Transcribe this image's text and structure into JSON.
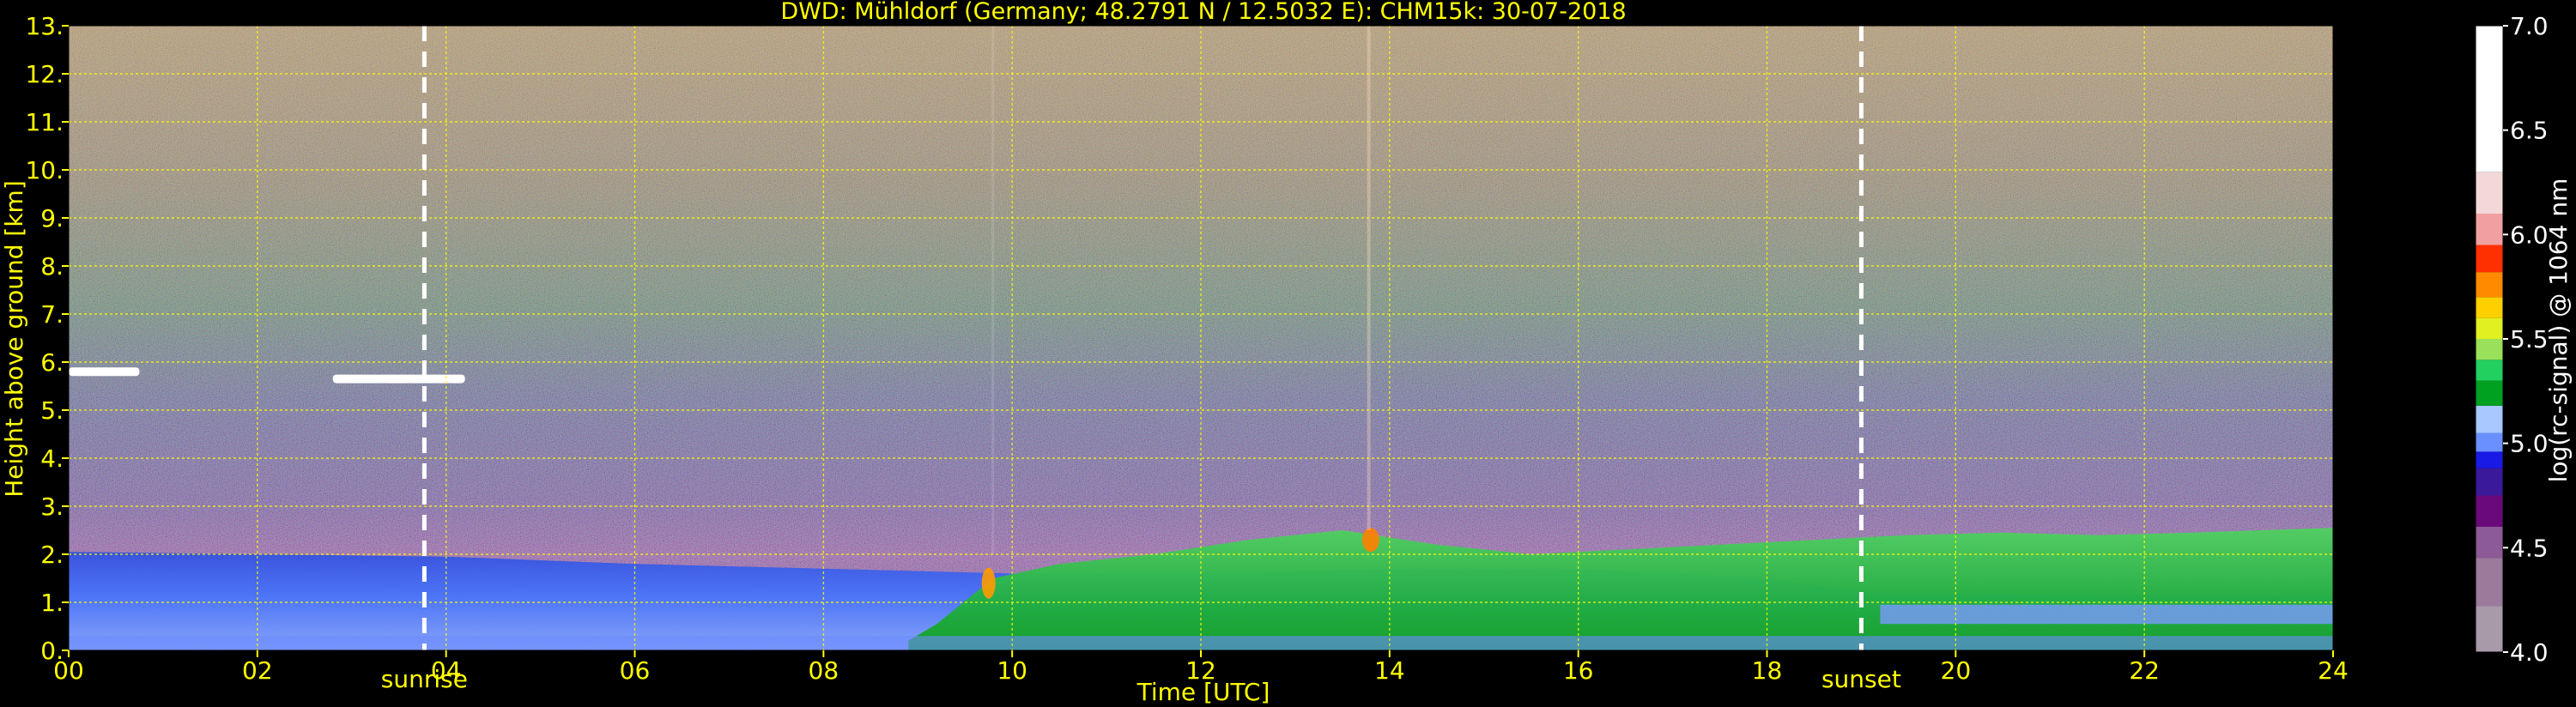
{
  "chart_data": {
    "type": "heatmap",
    "title": "DWD: Mühldorf (Germany; 48.2791 N / 12.5032 E):    CHM15k: 30-07-2018",
    "xlabel": "Time [UTC]",
    "ylabel": "Height above ground [km]",
    "xlim": [
      0,
      24
    ],
    "ylim": [
      0,
      13
    ],
    "x_ticks": [
      0,
      2,
      4,
      6,
      8,
      10,
      12,
      14,
      16,
      18,
      20,
      22,
      24
    ],
    "x_tick_labels": [
      "00",
      "02",
      "04",
      "06",
      "08",
      "10",
      "12",
      "14",
      "16",
      "18",
      "20",
      "22",
      "24"
    ],
    "y_ticks": [
      0,
      1,
      2,
      3,
      4,
      5,
      6,
      7,
      8,
      9,
      10,
      11,
      12,
      13
    ],
    "y_tick_labels": [
      "0.",
      "1.",
      "2.",
      "3.",
      "4.",
      "5.",
      "6.",
      "7.",
      "8.",
      "9.",
      "10.",
      "11.",
      "12.",
      "13."
    ],
    "grid": true,
    "colorbar": {
      "label": "log(rc-signal) @ 1064 nm",
      "range": [
        4.0,
        7.0
      ],
      "ticks": [
        4.0,
        4.5,
        5.0,
        5.5,
        6.0,
        6.5,
        7.0
      ],
      "tick_labels": [
        "4.0",
        "4.5",
        "5.0",
        "5.5",
        "6.0",
        "6.5",
        "7.0"
      ],
      "colors": [
        "#a89aa8",
        "#9c7a9c",
        "#8c5a96",
        "#6a0a7a",
        "#3a1a9a",
        "#1a1ae6",
        "#6a90ff",
        "#a8c8ff",
        "#00a020",
        "#22d060",
        "#9ae05a",
        "#e0f020",
        "#ffd000",
        "#ff8a00",
        "#ff3000",
        "#f0a0a0",
        "#f2d8d8",
        "#ffffff"
      ]
    },
    "annotations": [
      {
        "label": "sunrise",
        "x": 3.77
      },
      {
        "label": "sunset",
        "x": 19.0
      }
    ],
    "layers": [
      {
        "name": "background noise",
        "from_km": 3.0,
        "to_km": 13.0,
        "level": 4.8
      },
      {
        "name": "residual layer",
        "from_km": 1.0,
        "to_km": 2.0,
        "level": 5.1
      },
      {
        "name": "mixing layer",
        "from_km": 0.2,
        "to_km": 2.5,
        "level": 5.4
      },
      {
        "name": "cloud",
        "x": [
          0.0,
          0.75
        ],
        "height_km": 5.8,
        "level": 7.0
      },
      {
        "name": "cloud",
        "x": [
          2.8,
          4.2
        ],
        "height_km": 5.65,
        "level": 7.0
      }
    ]
  }
}
